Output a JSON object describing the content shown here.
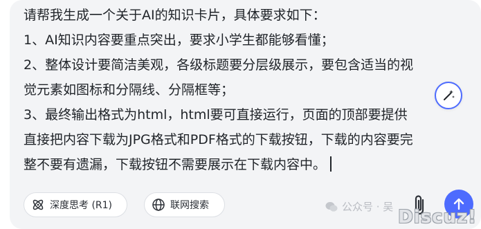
{
  "prompt": {
    "lines": [
      "请帮我生成一个关于AI的知识卡片，具体要求如下：",
      "1、AI知识内容要重点突出，要求小学生都能够看懂；",
      "2、整体设计要简洁美观，各级标题要分层级展示，要包含适当的视",
      "觉元素如图标和分隔线、分隔框等；",
      "3、最终输出格式为html，html要可直接运行，页面的顶部要提供",
      "直接把内容下载为JPG格式和PDF格式的下载按钮，下载的内容要完",
      "整不要有遗漏，下载按钮不需要展示在下载内容中。"
    ]
  },
  "toolbar": {
    "deep_think_label": "深度思考 (R1)",
    "web_search_label": "联网搜索"
  },
  "icons": {
    "optimize": "magic-wand-icon",
    "deep_think": "atom-icon",
    "web_search": "globe-icon",
    "attach": "paperclip-icon",
    "send": "arrow-up-icon",
    "watermark": "wechat-icon"
  },
  "watermark": {
    "text": "公众号 · 吴",
    "site": "Discuz!"
  },
  "colors": {
    "accent": "#4d6bfe",
    "composer_bg": "#f3f4f6",
    "text": "#1f2328"
  }
}
